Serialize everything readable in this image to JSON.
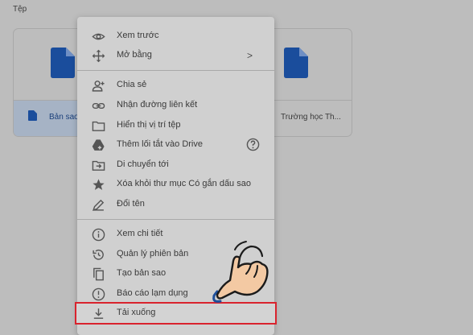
{
  "section": {
    "label": "Tệp"
  },
  "files": [
    {
      "name": "Bản sao",
      "selected": true
    },
    {
      "name": "Trường học Th...",
      "selected": false
    }
  ],
  "colors": {
    "doc_blue": "#1a4d9c",
    "highlight_red": "#d9232d"
  },
  "menu": {
    "items": [
      {
        "label": "Xem trước",
        "icon": "eye-icon"
      },
      {
        "label": "Mở bằng",
        "icon": "move-arrows-icon",
        "submenu": true
      },
      {
        "label": "Chia sẻ",
        "icon": "add-person-icon"
      },
      {
        "label": "Nhận đường liên kết",
        "icon": "link-icon"
      },
      {
        "label": "Hiển thị vị trí tệp",
        "icon": "folder-icon"
      },
      {
        "label": "Thêm lối tắt vào Drive",
        "icon": "drive-shortcut-icon",
        "help": true
      },
      {
        "label": "Di chuyển tới",
        "icon": "move-folder-icon"
      },
      {
        "label": "Xóa khỏi thư mục Có gắn dấu sao",
        "icon": "star-icon"
      },
      {
        "label": "Đổi tên",
        "icon": "pencil-icon"
      },
      {
        "label": "Xem chi tiết",
        "icon": "info-icon"
      },
      {
        "label": "Quản lý phiên bản",
        "icon": "history-icon"
      },
      {
        "label": "Tạo bản sao",
        "icon": "copy-icon"
      },
      {
        "label": "Báo cáo lạm dụng",
        "icon": "report-icon"
      },
      {
        "label": "Tải xuống",
        "icon": "download-icon",
        "highlighted": true
      }
    ]
  }
}
